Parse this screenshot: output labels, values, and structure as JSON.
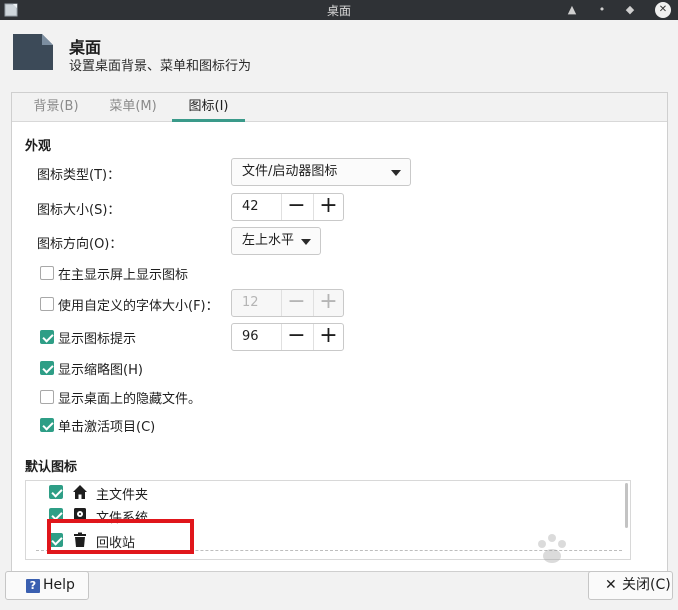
{
  "window": {
    "title": "桌面",
    "controls": [
      "▲",
      "•",
      "◆",
      "✕"
    ]
  },
  "header": {
    "title": "桌面",
    "subtitle": "设置桌面背景、菜单和图标行为"
  },
  "tabs": [
    {
      "label": "背景(B)",
      "active": false
    },
    {
      "label": "菜单(M)",
      "active": false
    },
    {
      "label": "图标(I)",
      "active": true
    }
  ],
  "appearance": {
    "section_title": "外观",
    "icon_type_label": "图标类型(T)：",
    "icon_type_value": "文件/启动器图标",
    "icon_size_label": "图标大小(S)：",
    "icon_size_value": "42",
    "icon_orientation_label": "图标方向(O)：",
    "icon_orientation_value": "左上水平",
    "show_on_primary_label": "在主显示屏上显示图标",
    "show_on_primary_checked": false,
    "custom_font_label": "使用自定义的字体大小(F)：",
    "custom_font_checked": false,
    "custom_font_value": "12",
    "show_tooltips_label": "显示图标提示",
    "show_tooltips_checked": true,
    "tooltip_size_value": "96",
    "show_thumbnails_label": "显示缩略图(H)",
    "show_thumbnails_checked": true,
    "show_hidden_label": "显示桌面上的隐藏文件。",
    "show_hidden_checked": false,
    "single_click_label": "单击激活项目(C)",
    "single_click_checked": true
  },
  "default_icons": {
    "section_title": "默认图标",
    "items": [
      {
        "label": "主文件夹",
        "icon": "home-icon",
        "checked": true
      },
      {
        "label": "文件系统",
        "icon": "drive-icon",
        "checked": true
      },
      {
        "label": "回收站",
        "icon": "trash-icon",
        "checked": true
      }
    ]
  },
  "footer": {
    "help_label": "Help",
    "help_icon": "?",
    "close_label": "关闭(C)",
    "close_icon": "✕"
  },
  "colors": {
    "accent": "#2e9e86",
    "highlight_box": "#e0161b"
  }
}
